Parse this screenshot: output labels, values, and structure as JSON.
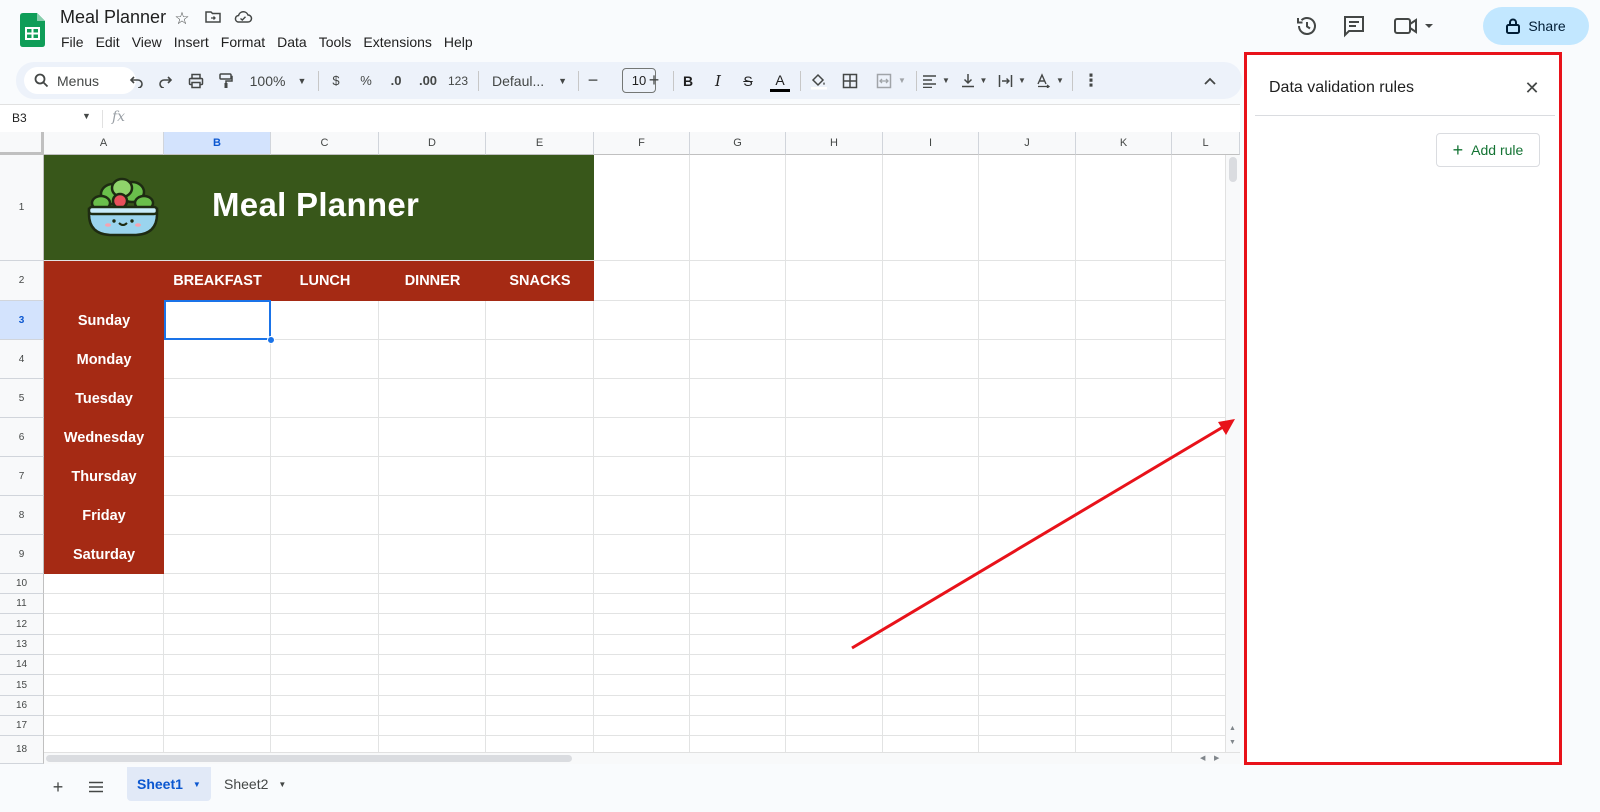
{
  "app": {
    "doc_title": "Meal Planner",
    "menus": [
      "File",
      "Edit",
      "View",
      "Insert",
      "Format",
      "Data",
      "Tools",
      "Extensions",
      "Help"
    ],
    "share_label": "Share"
  },
  "toolbar": {
    "search_label": "Menus",
    "zoom": "100%",
    "currency": "$",
    "percent": "%",
    "dec_decrease": ".0",
    "dec_increase": ".00",
    "number_format": "123",
    "font_name": "Defaul...",
    "font_size": "10",
    "bold": "B",
    "italic": "I",
    "strike": "S",
    "text_color": "A"
  },
  "formula_bar": {
    "name_box": "B3",
    "fx": "fx"
  },
  "sheet": {
    "columns": [
      "A",
      "B",
      "C",
      "D",
      "E",
      "F",
      "G",
      "H",
      "I",
      "J",
      "K",
      "L"
    ],
    "rows": [
      "1",
      "2",
      "3",
      "4",
      "5",
      "6",
      "7",
      "8",
      "9",
      "10",
      "11",
      "12",
      "13",
      "14",
      "15",
      "16",
      "17",
      "18"
    ],
    "selected_cell": "B3",
    "banner_title": "Meal Planner",
    "meal_headers": [
      "BREAKFAST",
      "LUNCH",
      "DINNER",
      "SNACKS"
    ],
    "days": [
      "Sunday",
      "Monday",
      "Tuesday",
      "Wednesday",
      "Thursday",
      "Friday",
      "Saturday"
    ],
    "colors": {
      "banner_green": "#38571a",
      "header_red": "#a52a14",
      "selection_blue": "#1a73e8"
    }
  },
  "sheet_tabs": [
    {
      "label": "Sheet1",
      "active": true
    },
    {
      "label": "Sheet2",
      "active": false
    }
  ],
  "side_panel": {
    "title": "Data validation rules",
    "add_rule_label": "Add rule",
    "highlight_color": "#e8121a"
  },
  "icons": {
    "logo": "google-sheets-logo",
    "star": "star-icon",
    "move": "move-to-folder-icon",
    "cloud": "cloud-saved-icon",
    "history": "history-icon",
    "comments": "comment-icon",
    "meet": "video-camera-icon",
    "lock": "lock-icon",
    "salad": "salad-bowl-icon"
  }
}
